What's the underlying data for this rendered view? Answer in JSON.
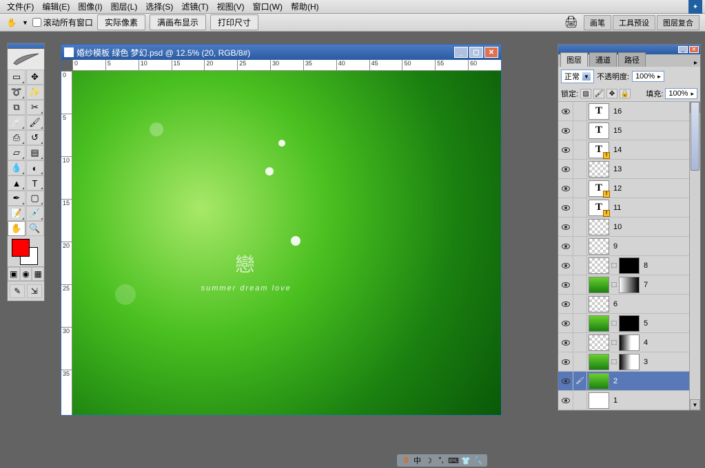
{
  "menu": [
    "文件(F)",
    "编辑(E)",
    "图像(I)",
    "图层(L)",
    "选择(S)",
    "滤镜(T)",
    "视图(V)",
    "窗口(W)",
    "帮助(H)"
  ],
  "options": {
    "scroll_all": "滚动所有窗口",
    "btn_actual": "实际像素",
    "btn_fit": "满画布显示",
    "btn_print": "打印尺寸",
    "tab_brush": "画笔",
    "tab_tool_preset": "工具预设",
    "tab_layer_comp": "图层复合"
  },
  "doc": {
    "title": "婚纱模板 绿色 梦幻.psd @ 12.5% (20, RGB/8#)",
    "ruler_h": [
      "0",
      "5",
      "10",
      "15",
      "20",
      "25",
      "30",
      "35",
      "40",
      "45",
      "50",
      "55",
      "60"
    ],
    "ruler_v": [
      "0",
      "5",
      "10",
      "15",
      "20",
      "25",
      "30",
      "35"
    ],
    "overlay_char": "戀",
    "overlay_text": "summer  dream  love"
  },
  "layers_panel": {
    "tabs": [
      "图层",
      "通道",
      "路径"
    ],
    "blend_label": "正常",
    "opacity_label": "不透明度:",
    "opacity_value": "100%",
    "lock_label": "锁定:",
    "fill_label": "填充:",
    "fill_value": "100%",
    "layers": [
      {
        "vis": true,
        "thumb": "T",
        "warn": false,
        "name": "16"
      },
      {
        "vis": true,
        "thumb": "T",
        "warn": false,
        "name": "15"
      },
      {
        "vis": true,
        "thumb": "T",
        "warn": true,
        "name": "14"
      },
      {
        "vis": true,
        "thumb": "checker",
        "warn": false,
        "name": "13"
      },
      {
        "vis": true,
        "thumb": "T",
        "warn": true,
        "name": "12"
      },
      {
        "vis": true,
        "thumb": "T",
        "warn": true,
        "name": "11"
      },
      {
        "vis": true,
        "thumb": "checker",
        "warn": false,
        "name": "10"
      },
      {
        "vis": true,
        "thumb": "checker",
        "warn": false,
        "name": "9"
      },
      {
        "vis": true,
        "thumb": "checker",
        "mask": "black",
        "name": "8"
      },
      {
        "vis": true,
        "thumb": "green",
        "mask": "grad",
        "name": "7"
      },
      {
        "vis": true,
        "thumb": "checker",
        "warn": false,
        "name": "6"
      },
      {
        "vis": true,
        "thumb": "green",
        "mask": "black",
        "name": "5"
      },
      {
        "vis": true,
        "thumb": "checker",
        "mask": "grad2",
        "name": "4"
      },
      {
        "vis": true,
        "thumb": "green",
        "mask": "grad2",
        "name": "3"
      },
      {
        "vis": true,
        "thumb": "green",
        "warn": false,
        "name": "2",
        "active": true
      },
      {
        "vis": true,
        "thumb": "white",
        "warn": false,
        "name": "1"
      }
    ]
  },
  "taskbar": {
    "label": "中"
  },
  "colors": {
    "fg": "#ff0000",
    "bg": "#ffffff",
    "accent": "#3a6ab0"
  }
}
